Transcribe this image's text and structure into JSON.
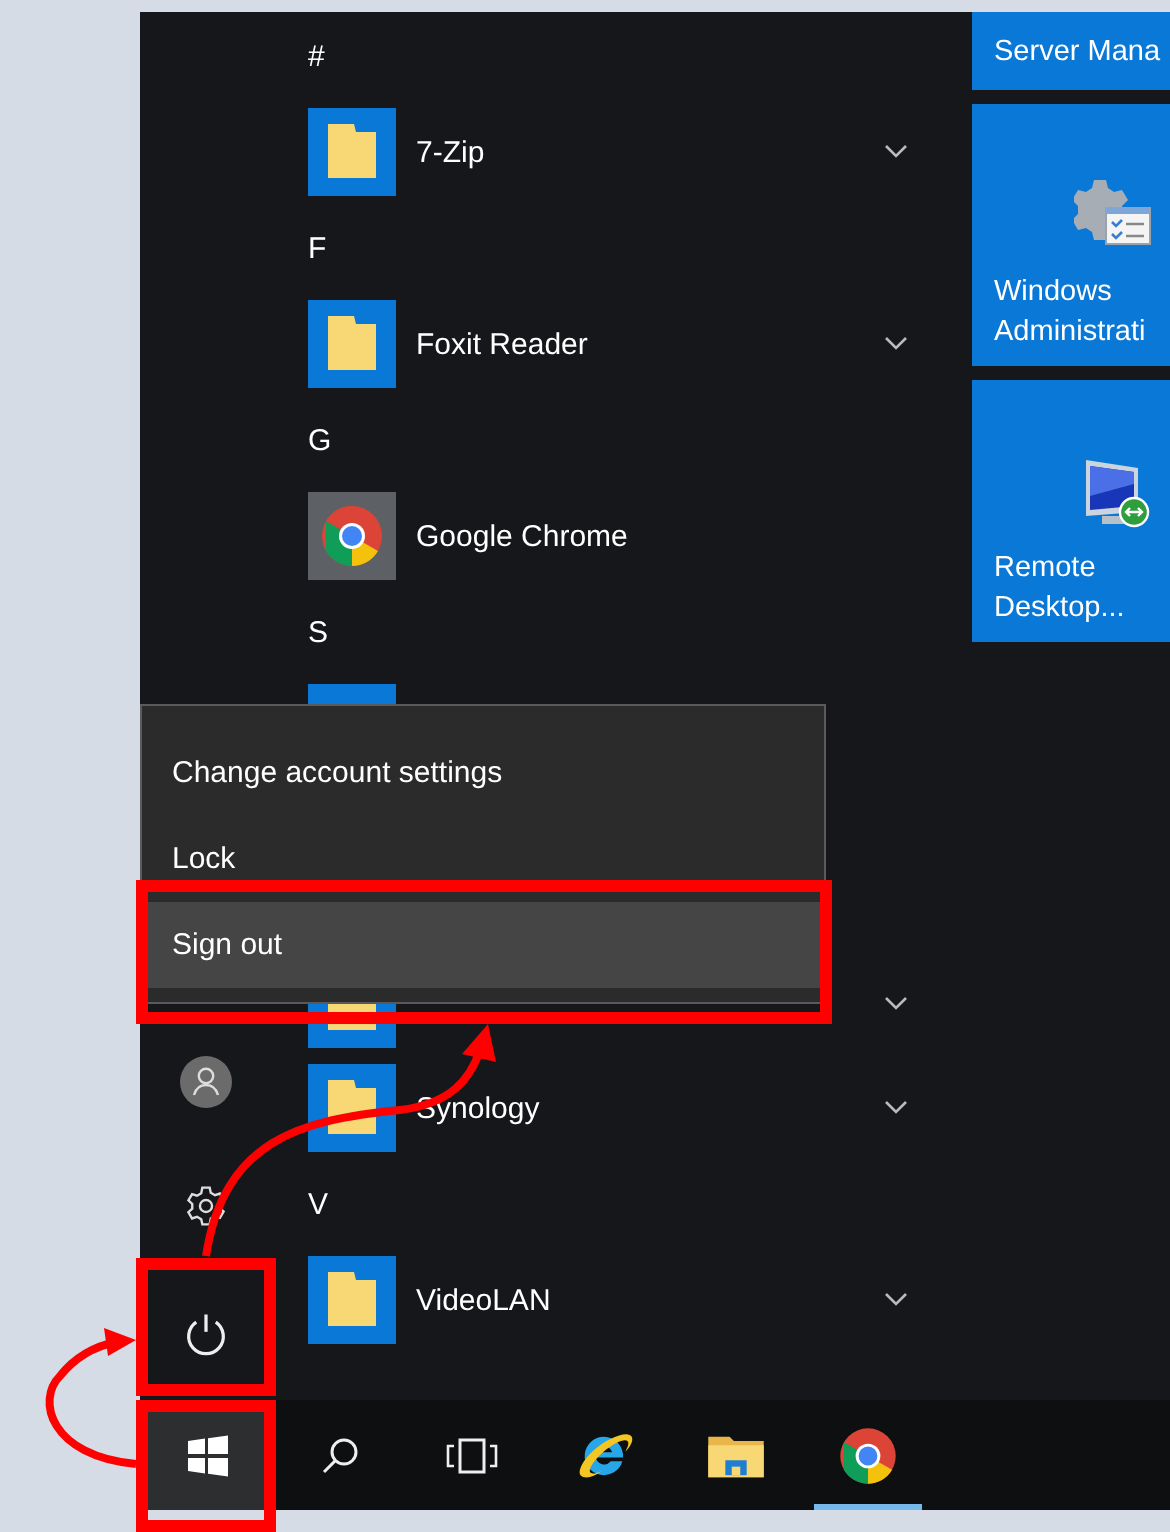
{
  "start_menu": {
    "app_list_top": [
      {
        "kind": "header",
        "label": "#"
      },
      {
        "kind": "folder-app",
        "label": "7-Zip",
        "expandable": true
      },
      {
        "kind": "header",
        "label": "F"
      },
      {
        "kind": "folder-app",
        "label": "Foxit Reader",
        "expandable": true
      },
      {
        "kind": "header",
        "label": "G"
      },
      {
        "kind": "chrome-app",
        "label": "Google Chrome",
        "expandable": false
      },
      {
        "kind": "header",
        "label": "S"
      },
      {
        "kind": "generic-app",
        "expandable": false
      }
    ],
    "app_list_bottom": [
      {
        "kind": "folder-app",
        "expandable": true
      },
      {
        "kind": "folder-app",
        "label": "Synology",
        "expandable": true
      },
      {
        "kind": "header",
        "label": "V"
      },
      {
        "kind": "folder-app",
        "label": "VideoLAN",
        "expandable": true
      }
    ],
    "power_menu": [
      {
        "label": "Change account settings",
        "selected": false
      },
      {
        "label": "Lock",
        "selected": false
      },
      {
        "label": "Sign out",
        "selected": true
      }
    ],
    "tiles": [
      {
        "kind": "plain",
        "label": "Server Mana"
      },
      {
        "kind": "admin-tools",
        "label": "Windows Administrati"
      },
      {
        "kind": "remote-desktop",
        "label": "Remote Desktop..."
      }
    ]
  },
  "taskbar": {
    "buttons": [
      {
        "kind": "start",
        "running": false
      },
      {
        "kind": "search",
        "running": false
      },
      {
        "kind": "task-view",
        "running": false
      },
      {
        "kind": "ie",
        "running": false
      },
      {
        "kind": "explorer",
        "running": false
      },
      {
        "kind": "chrome",
        "running": true
      }
    ]
  }
}
